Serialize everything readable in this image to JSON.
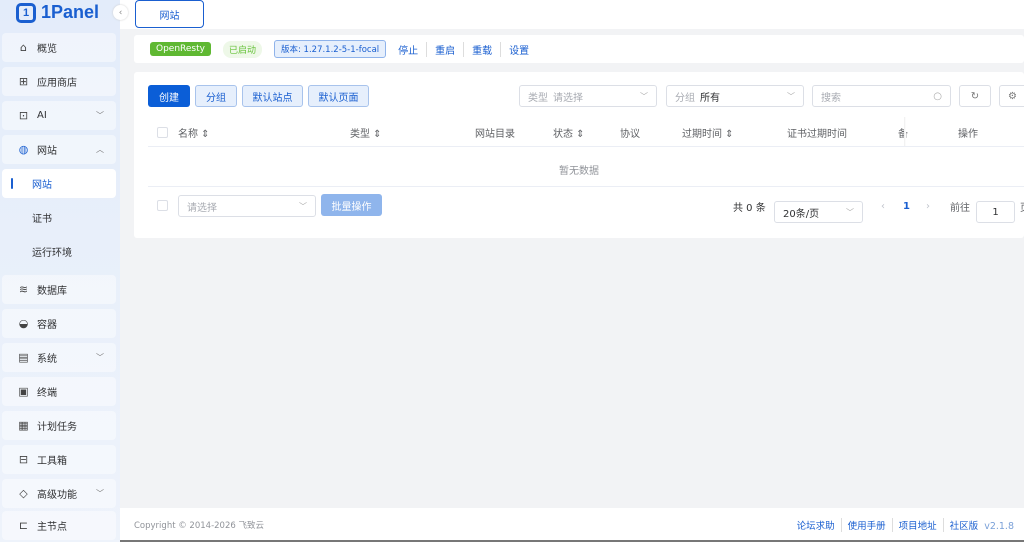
{
  "app": {
    "logo": "1Panel"
  },
  "sidebar": {
    "items": [
      {
        "label": "概览",
        "icon": "home-icon"
      },
      {
        "label": "应用商店",
        "icon": "apps-icon"
      },
      {
        "label": "AI",
        "icon": "robot-icon"
      },
      {
        "label": "网站",
        "icon": "globe-icon"
      },
      {
        "label": "数据库",
        "icon": "database-icon"
      },
      {
        "label": "容器",
        "icon": "container-icon"
      },
      {
        "label": "系统",
        "icon": "server-icon"
      },
      {
        "label": "终端",
        "icon": "terminal-icon"
      },
      {
        "label": "计划任务",
        "icon": "calendar-icon"
      },
      {
        "label": "工具箱",
        "icon": "toolbox-icon"
      },
      {
        "label": "高级功能",
        "icon": "diamond-icon"
      },
      {
        "label": "主节点",
        "icon": "node-icon"
      }
    ],
    "submenu": [
      "网站",
      "证书",
      "运行环境"
    ]
  },
  "tabs": {
    "active": "网站"
  },
  "status": {
    "app": "OpenResty",
    "state": "已启动",
    "version": "版本: 1.27.1.2-5-1-focal",
    "actions": [
      "停止",
      "重启",
      "重载",
      "设置"
    ]
  },
  "toolbar": {
    "create": "创建",
    "group": "分组",
    "default_site": "默认站点",
    "default_page": "默认页面",
    "type_label": "类型",
    "type_placeholder": "请选择",
    "group_label": "分组",
    "group_value": "所有",
    "search_placeholder": "搜索"
  },
  "table": {
    "columns": [
      "名称",
      "类型",
      "网站目录",
      "状态",
      "协议",
      "过期时间",
      "证书过期时间",
      "备",
      "操作"
    ],
    "empty": "暂无数据"
  },
  "batch": {
    "placeholder": "请选择",
    "button": "批量操作"
  },
  "pagination": {
    "total": "共 0 条",
    "page_size": "20条/页",
    "current": "1",
    "goto": "前往",
    "goto_value": "1",
    "page_suffix": "页"
  },
  "footer": {
    "copyright": "Copyright © 2014-2026 飞致云",
    "links": [
      "论坛求助",
      "使用手册",
      "项目地址",
      "社区版"
    ],
    "version": "v2.1.8"
  },
  "colors": {
    "primary": "#0b5ed7",
    "success": "#5fb832"
  }
}
